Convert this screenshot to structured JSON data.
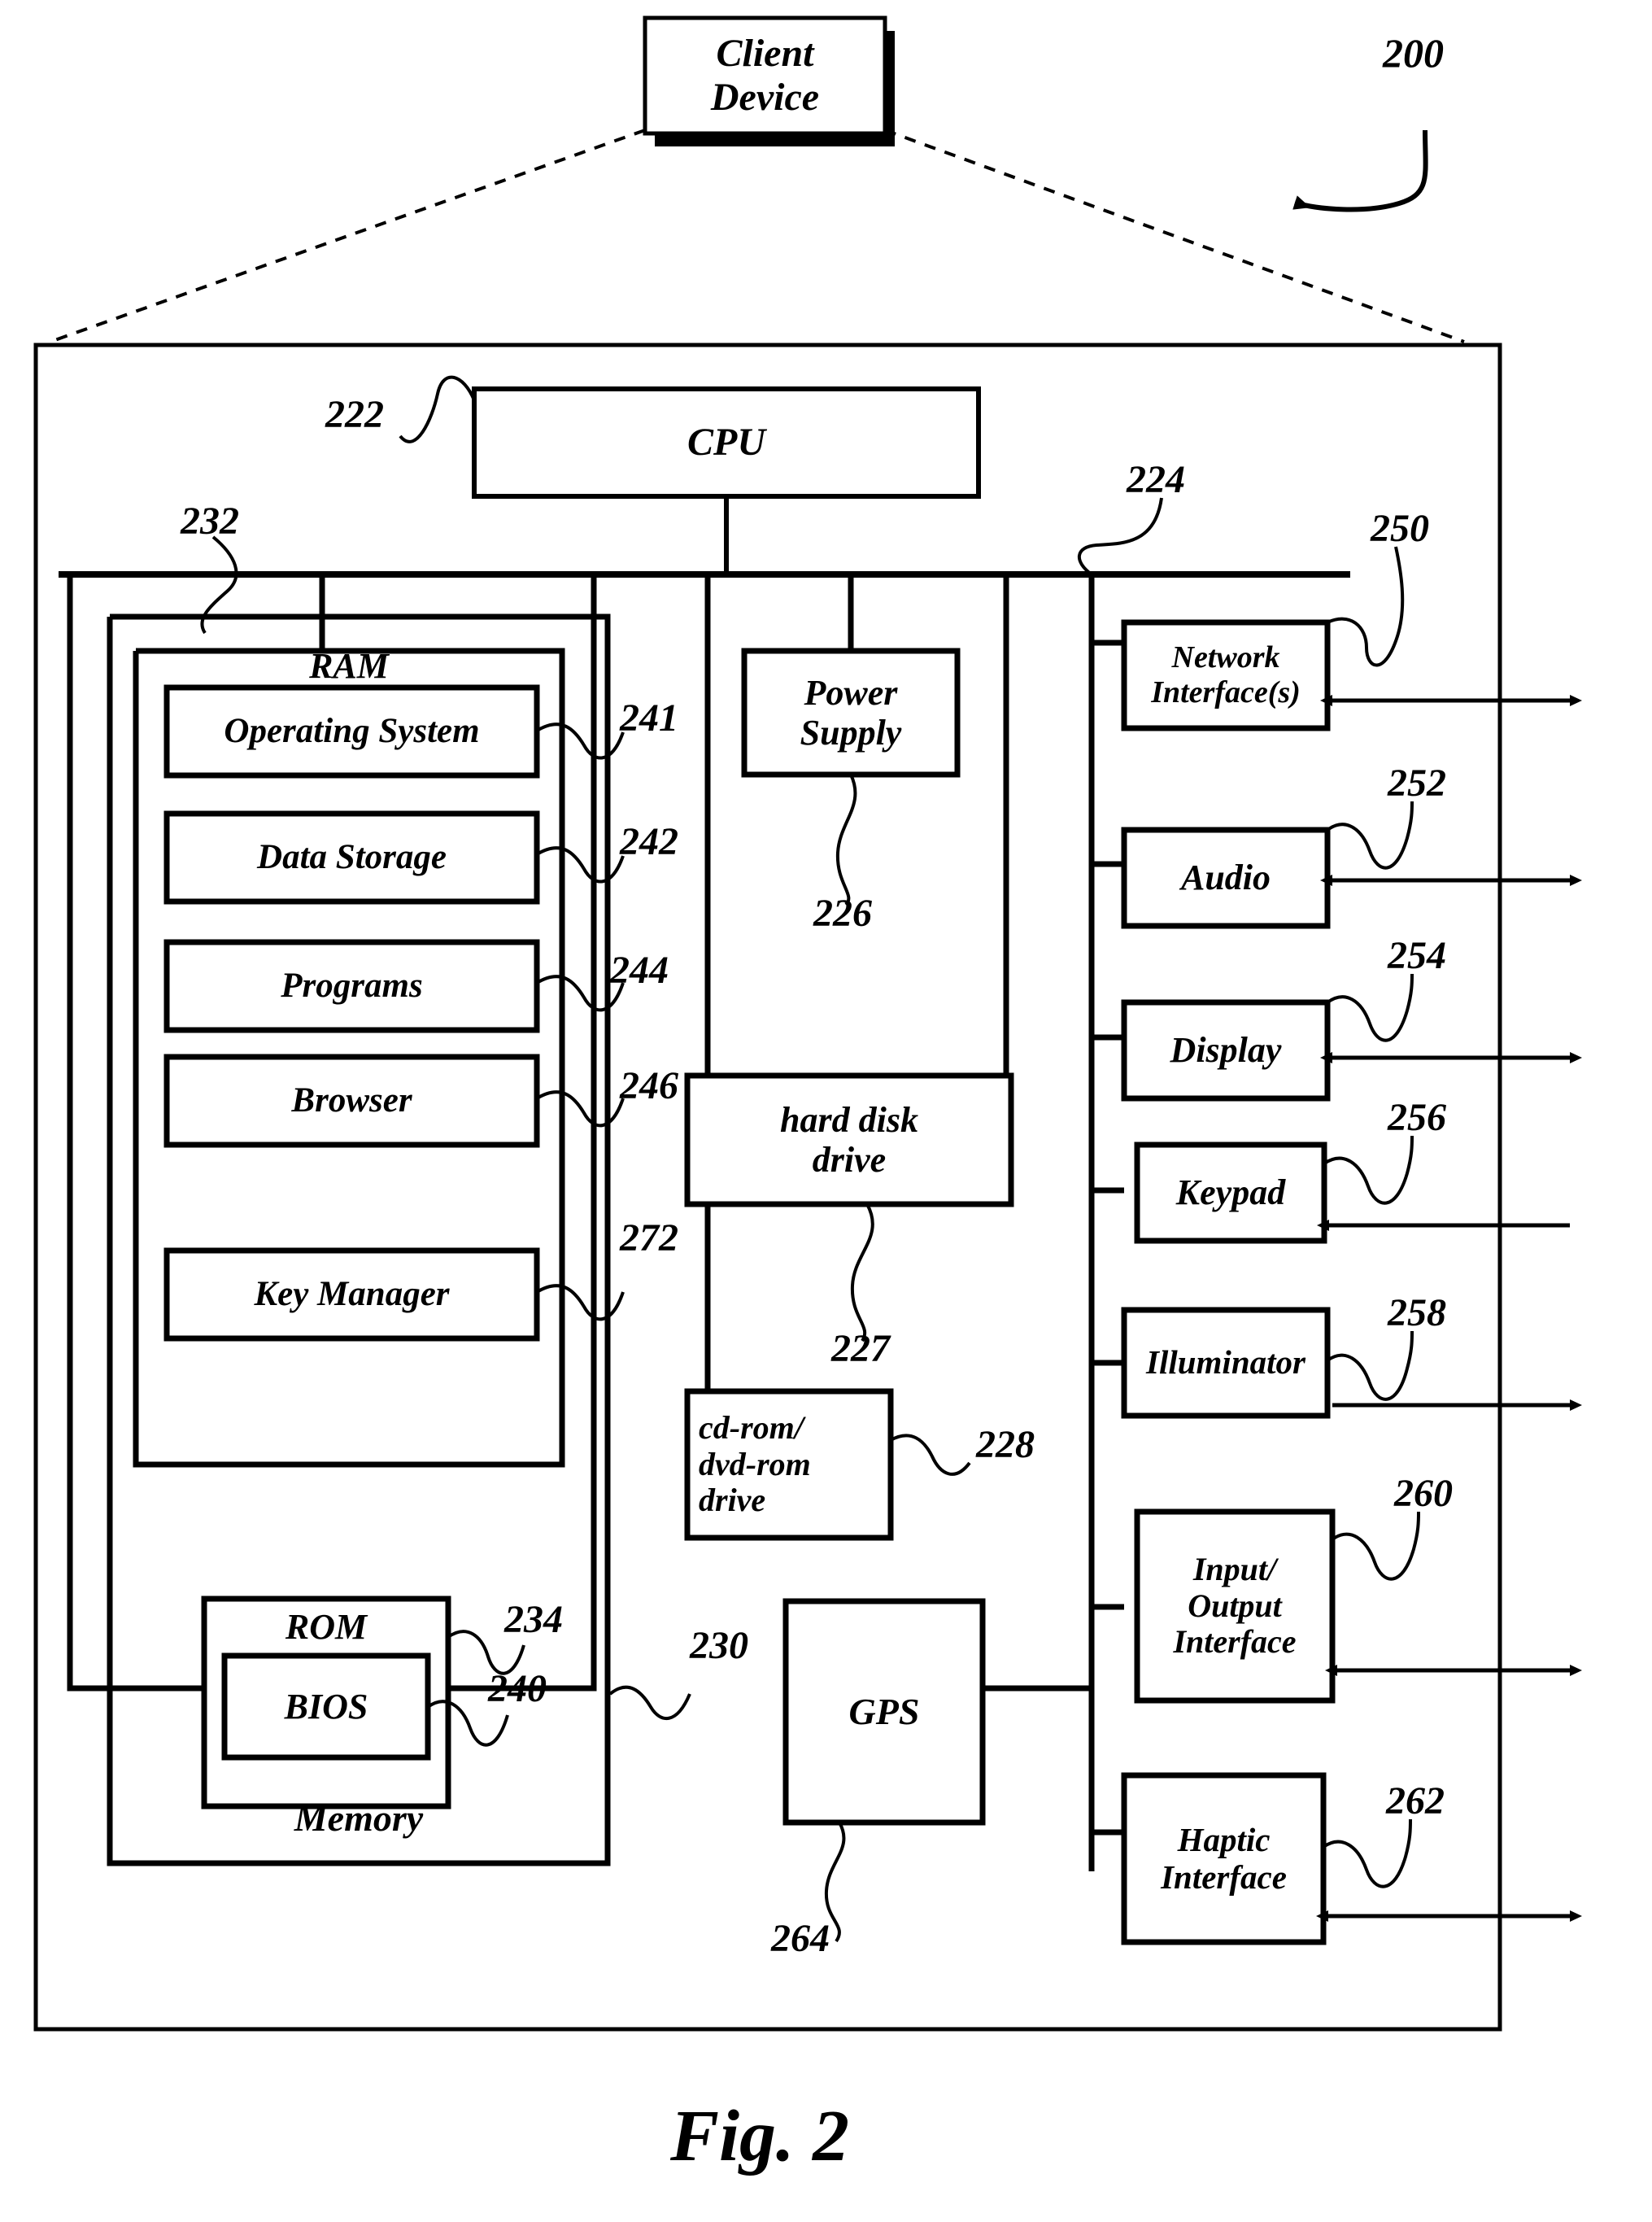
{
  "figure": {
    "caption": "Fig. 2",
    "overall_ref": "200"
  },
  "client_device": {
    "label": "Client Device",
    "lines": [
      "Client",
      "Device"
    ]
  },
  "cpu": {
    "label": "CPU",
    "ref": "222"
  },
  "bus": {
    "memory_bus_ref": "232",
    "peripheral_bus_ref": "224"
  },
  "memory": {
    "label": "Memory",
    "ram_label": "RAM",
    "ram_modules": [
      {
        "label": "Operating System",
        "ref": "241"
      },
      {
        "label": "Data Storage",
        "ref": "242"
      },
      {
        "label": "Programs",
        "ref": "244"
      },
      {
        "label": "Browser",
        "ref": "246"
      },
      {
        "label": "Key Manager",
        "ref": "272"
      }
    ],
    "rom": {
      "label": "ROM",
      "ref": "234"
    },
    "bios": {
      "label": "BIOS",
      "ref": "240"
    }
  },
  "middle_column": [
    {
      "label": "Power Supply",
      "lines": [
        "Power",
        "Supply"
      ],
      "ref": "226"
    },
    {
      "label": "hard disk drive",
      "lines": [
        "hard disk",
        "drive"
      ],
      "ref": "227"
    },
    {
      "label": "cd-rom/ dvd-rom drive",
      "lines": [
        "cd-rom/",
        "dvd-rom",
        "drive"
      ],
      "ref": "228"
    }
  ],
  "gps": {
    "label": "GPS",
    "ref_left": "230",
    "ref_below": "264"
  },
  "peripherals": [
    {
      "label": "Network Interface(s)",
      "lines": [
        "Network",
        "Interface(s)"
      ],
      "ref": "250",
      "arrow": "bidirectional"
    },
    {
      "label": "Audio",
      "lines": [
        "Audio"
      ],
      "ref": "252",
      "arrow": "bidirectional"
    },
    {
      "label": "Display",
      "lines": [
        "Display"
      ],
      "ref": "254",
      "arrow": "bidirectional"
    },
    {
      "label": "Keypad",
      "lines": [
        "Keypad"
      ],
      "ref": "256",
      "arrow": "inbound"
    },
    {
      "label": "Illuminator",
      "lines": [
        "Illuminator"
      ],
      "ref": "258",
      "arrow": "outbound"
    },
    {
      "label": "Input/ Output Interface",
      "lines": [
        "Input/",
        "Output",
        "Interface"
      ],
      "ref": "260",
      "arrow": "bidirectional"
    },
    {
      "label": "Haptic Interface",
      "lines": [
        "Haptic",
        "Interface"
      ],
      "ref": "262",
      "arrow": "bidirectional"
    }
  ],
  "colors": {
    "stroke": "#000000",
    "background": "#ffffff"
  }
}
